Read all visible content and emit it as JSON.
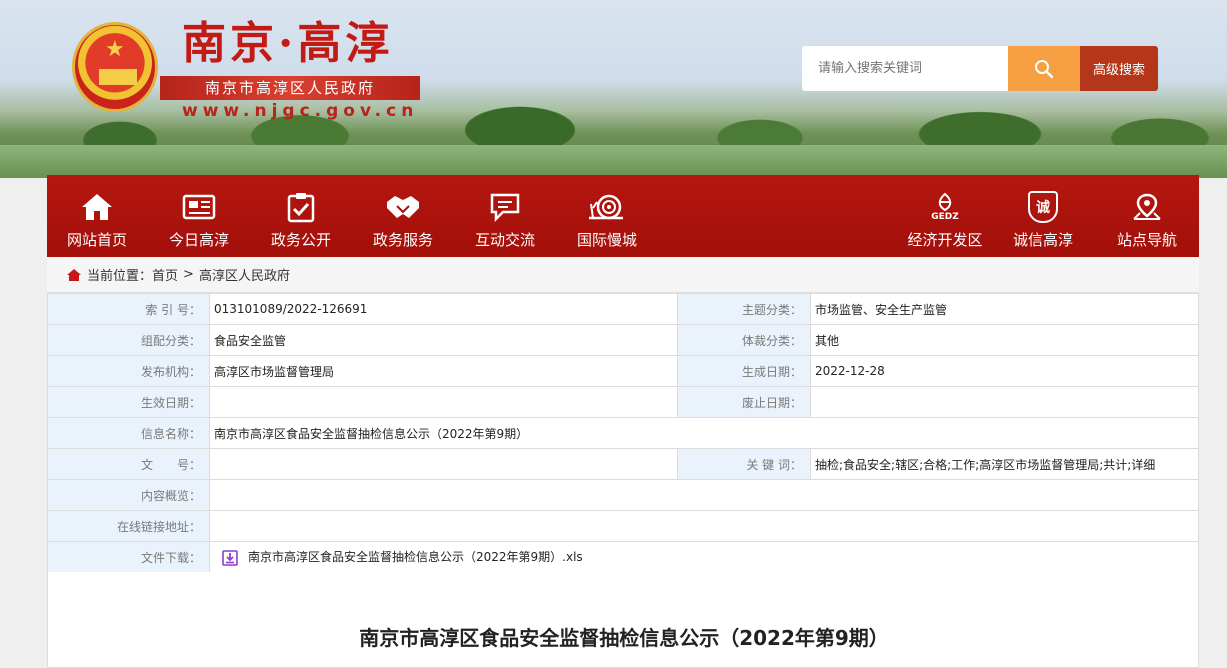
{
  "header": {
    "title": "南京·高淳",
    "subtitle": "南京市高淳区人民政府",
    "url": "www.njgc.gov.cn",
    "search_placeholder": "请输入搜索关键词",
    "advanced_search": "高级搜索"
  },
  "nav": {
    "items": [
      {
        "label": "网站首页",
        "icon": "home-icon"
      },
      {
        "label": "今日高淳",
        "icon": "newspaper-icon"
      },
      {
        "label": "政务公开",
        "icon": "clipboard-check-icon"
      },
      {
        "label": "政务服务",
        "icon": "handshake-icon"
      },
      {
        "label": "互动交流",
        "icon": "chat-icon"
      },
      {
        "label": "国际慢城",
        "icon": "snail-icon"
      },
      {
        "label": "经济开发区",
        "icon": "gedz-logo-icon"
      },
      {
        "label": "诚信高淳",
        "icon": "integrity-shield-icon"
      },
      {
        "label": "站点导航",
        "icon": "map-pin-icon"
      }
    ],
    "gedz_text": "GEDZ",
    "cheng_text": "诚"
  },
  "breadcrumb": {
    "prefix": "当前位置：",
    "home": "首页",
    "separator": ">",
    "current": "高淳区人民政府"
  },
  "info": {
    "index_label": "索 引 号：",
    "index_value": "013101089/2022-126691",
    "topic_label": "主题分类：",
    "topic_value": "市场监管、安全生产监管",
    "group_label": "组配分类：",
    "group_value": "食品安全监管",
    "genre_label": "体裁分类：",
    "genre_value": "其他",
    "publisher_label": "发布机构：",
    "publisher_value": "高淳区市场监督管理局",
    "created_label": "生成日期：",
    "created_value": "2022-12-28",
    "effective_label": "生效日期：",
    "effective_value": "",
    "abolished_label": "废止日期：",
    "abolished_value": "",
    "name_label": "信息名称：",
    "name_value": "南京市高淳区食品安全监督抽检信息公示（2022年第9期）",
    "docno_label": "文　　号：",
    "docno_value": "",
    "keywords_label": "关 键 词：",
    "keywords_value": "抽检;食品安全;辖区;合格;工作;高淳区市场监督管理局;共计;详细",
    "summary_label": "内容概览：",
    "summary_value": "",
    "link_label": "在线链接地址：",
    "link_value": "",
    "download_label": "文件下载：",
    "download_value": "南京市高淳区食品安全监督抽检信息公示（2022年第9期）.xls"
  },
  "article": {
    "title": "南京市高淳区食品安全监督抽检信息公示（2022年第9期）"
  }
}
